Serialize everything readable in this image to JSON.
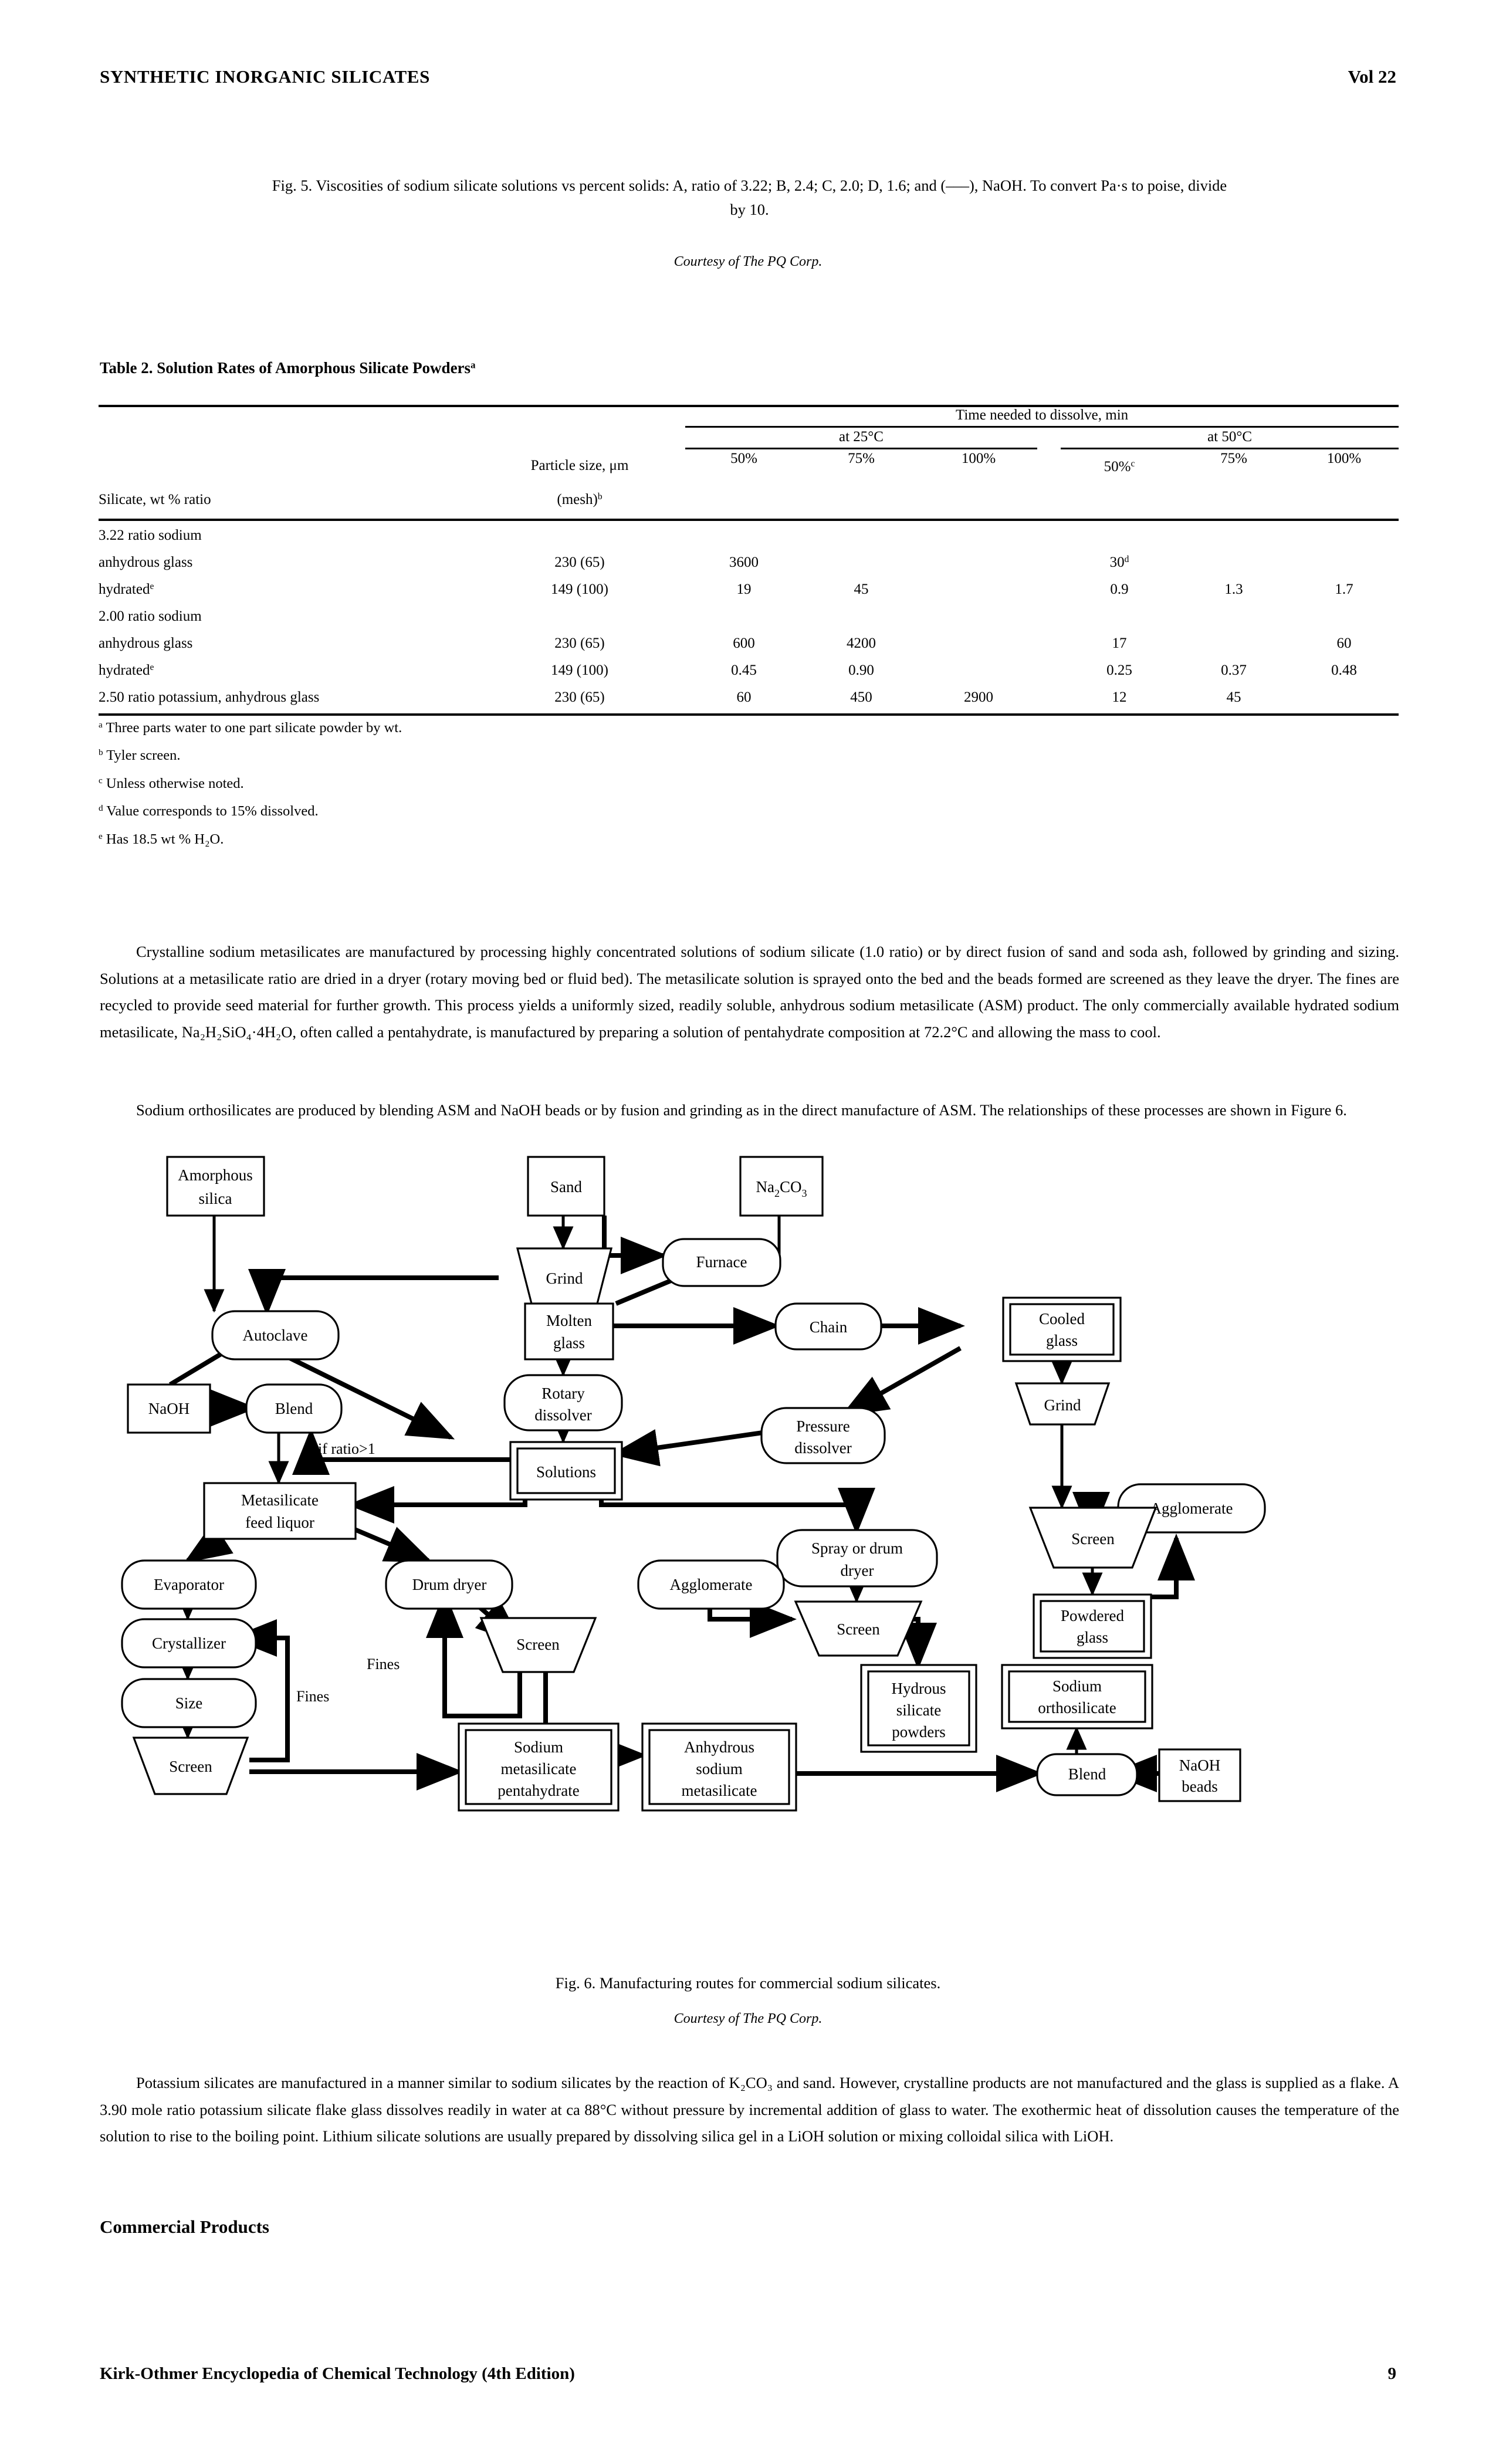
{
  "runhead": {
    "title": "SYNTHETIC INORGANIC SILICATES",
    "volume": "Vol 22"
  },
  "fig5": {
    "caption_line1": "Fig. 5. Viscosities of sodium silicate solutions vs percent solids: A, ratio of 3.22; B, 2.4; C, 2.0; D, 1.6; and (–––), NaOH. To convert Pa·s to poise, divide",
    "caption_line2": "by 10.",
    "courtesy": "Courtesy of The PQ Corp."
  },
  "table2": {
    "title_main": "Table 2. Solution Rates of Amorphous Silicate Powders",
    "title_sup": "a",
    "col_silicate": "Silicate, wt % ratio",
    "col_particle_line1": "Particle size, μm",
    "col_particle_line2": "(mesh)",
    "col_particle_sup": "b",
    "span_top": "Time needed to dissolve, min",
    "span_25": "at 25°C",
    "span_50": "at 50°C",
    "subheads": [
      "50%",
      "75%",
      "100%",
      "50%",
      "75%",
      "100%"
    ],
    "subhead_50c_sup": "c",
    "rows": [
      {
        "kind": "group",
        "label": "3.22 ratio sodium",
        "sup": "",
        "particle": "",
        "cells": [
          "",
          "",
          "",
          "",
          "",
          ""
        ]
      },
      {
        "kind": "data",
        "label": "anhydrous glass",
        "sup": "",
        "particle": "230 (65)",
        "cells": [
          "3600",
          "",
          "",
          "30",
          "",
          ""
        ],
        "cell_sup_index": 3,
        "cell_sup": "d"
      },
      {
        "kind": "data",
        "label": "hydrated",
        "sup": "e",
        "particle": "149 (100)",
        "cells": [
          "19",
          "45",
          "",
          "0.9",
          "1.3",
          "1.7"
        ]
      },
      {
        "kind": "group",
        "label": "2.00 ratio sodium",
        "sup": "",
        "particle": "",
        "cells": [
          "",
          "",
          "",
          "",
          "",
          ""
        ]
      },
      {
        "kind": "data",
        "label": "anhydrous glass",
        "sup": "",
        "particle": "230 (65)",
        "cells": [
          "600",
          "4200",
          "",
          "17",
          "",
          "60"
        ]
      },
      {
        "kind": "data",
        "label": "hydrated",
        "sup": "e",
        "particle": "149 (100)",
        "cells": [
          "0.45",
          "0.90",
          "",
          "0.25",
          "0.37",
          "0.48"
        ]
      },
      {
        "kind": "data",
        "label": "2.50 ratio potassium, anhydrous glass",
        "sup": "",
        "particle": "230 (65)",
        "cells": [
          "60",
          "450",
          "2900",
          "12",
          "45",
          ""
        ]
      }
    ],
    "footnotes": [
      {
        "mark": "a",
        "text": "Three parts water to one part silicate powder by wt."
      },
      {
        "mark": "b",
        "text": "Tyler screen."
      },
      {
        "mark": "c",
        "text": "Unless otherwise noted."
      },
      {
        "mark": "d",
        "text": "Value corresponds to 15% dissolved."
      },
      {
        "mark": "e",
        "text": "Has 18.5 wt % H₂O."
      }
    ]
  },
  "body": {
    "para1": "Crystalline sodium metasilicates are manufactured by processing highly concentrated solutions of sodium silicate (1.0 ratio) or by direct fusion of sand and soda ash, followed by grinding and sizing. Solutions at a metasilicate ratio are dried in a dryer (rotary moving bed or fluid bed). The metasilicate solution is sprayed onto the bed and the beads formed are screened as they leave the dryer. The fines are recycled to provide seed material for further growth. This process yields a uniformly sized, readily soluble, anhydrous sodium metasilicate (ASM) product. The only commercially available hydrated sodium metasilicate, Na₂H₂SiO₄·4H₂O, often called a pentahydrate, is manufactured by preparing a solution of pentahydrate composition at 72.2°C and allowing the mass to cool.",
    "para2": "Sodium orthosilicates are produced by blending ASM and NaOH beads or by fusion and grinding as in the direct manufacture of ASM. The relationships of these processes are shown in Figure 6.",
    "para3": "Potassium silicates are manufactured in a manner similar to sodium silicates by the reaction of K₂CO₃ and sand. However, crystalline products are not manufactured and the glass is supplied as a flake. A 3.90 mole ratio potassium silicate flake glass dissolves readily in water at ca 88°C without pressure by incremental addition of glass to water. The exothermic heat of dissolution causes the temperature of the solution to rise to the boiling point. Lithium silicate solutions are usually prepared by dissolving silica gel in a LiOH solution or mixing colloidal silica with LiOH.",
    "section_heading": "Commercial Products"
  },
  "fig6": {
    "caption": "Fig. 6. Manufacturing routes for commercial sodium silicates.",
    "courtesy": "Courtesy of The PQ Corp.",
    "nodes": {
      "amorphous_silica_l1": "Amorphous",
      "amorphous_silica_l2": "silica",
      "sand": "Sand",
      "na2co3": "Na₂CO₃",
      "grind_top": "Grind",
      "furnace": "Furnace",
      "autoclave": "Autoclave",
      "molten_glass_l1": "Molten",
      "molten_glass_l2": "glass",
      "chain": "Chain",
      "cooled_glass_l1": "Cooled",
      "cooled_glass_l2": "glass",
      "naoh": "NaOH",
      "blend_left": "Blend",
      "rotary_dissolver_l1": "Rotary",
      "rotary_dissolver_l2": "dissolver",
      "pressure_dissolver_l1": "Pressure",
      "pressure_dissolver_l2": "dissolver",
      "grind_right": "Grind",
      "solutions": "Solutions",
      "agglomerate_right": "Agglomerate",
      "metasilicate_feed_l1": "Metasilicate",
      "metasilicate_feed_l2": "feed liquor",
      "spray_drum_dryer_l1": "Spray or drum",
      "spray_drum_dryer_l2": "dryer",
      "screen_right": "Screen",
      "evaporator": "Evaporator",
      "drum_dryer": "Drum dryer",
      "agglomerate_mid": "Agglomerate",
      "screen_mid": "Screen",
      "powdered_glass_l1": "Powdered",
      "powdered_glass_l2": "glass",
      "crystallizer": "Crystallizer",
      "screen_drum": "Screen",
      "hydrous_l1": "Hydrous",
      "hydrous_l2": "silicate",
      "hydrous_l3": "powders",
      "sodium_ortho_l1": "Sodium",
      "sodium_ortho_l2": "orthosilicate",
      "size": "Size",
      "screen_left": "Screen",
      "sodium_penta_l1": "Sodium",
      "sodium_penta_l2": "metasilicate",
      "sodium_penta_l3": "pentahydrate",
      "anhydrous_l1": "Anhydrous",
      "anhydrous_l2": "sodium",
      "anhydrous_l3": "metasilicate",
      "blend_right": "Blend",
      "naoh_beads_l1": "NaOH",
      "naoh_beads_l2": "beads"
    },
    "edge_labels": {
      "if_ratio": "if ratio>1",
      "fines_left": "Fines",
      "fines_mid": "Fines"
    }
  },
  "footer": {
    "left": "Kirk-Othmer Encyclopedia of Chemical Technology (4th Edition)",
    "page": "9"
  }
}
